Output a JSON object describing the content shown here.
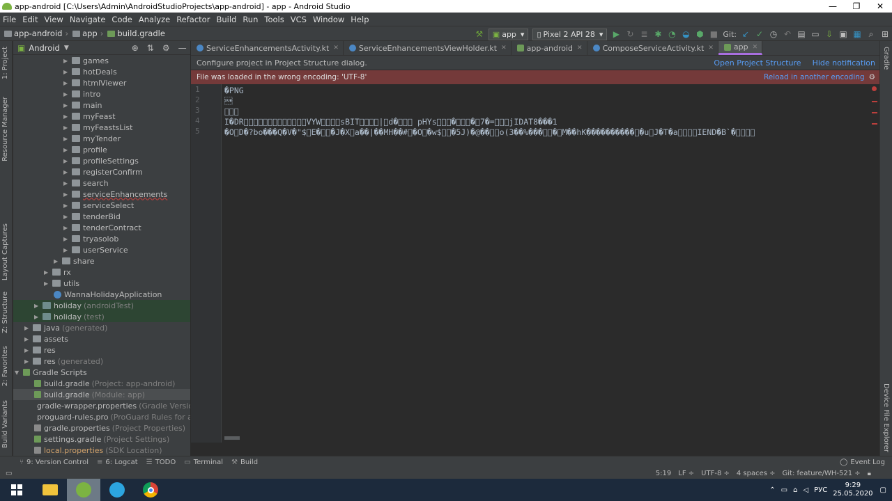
{
  "window": {
    "title": "app-android [C:\\Users\\Admin\\AndroidStudioProjects\\app-android] - app - Android Studio",
    "controls": [
      "—",
      "❐",
      "✕"
    ]
  },
  "menu": [
    "File",
    "Edit",
    "View",
    "Navigate",
    "Code",
    "Analyze",
    "Refactor",
    "Build",
    "Run",
    "Tools",
    "VCS",
    "Window",
    "Help"
  ],
  "navbar": {
    "breadcrumbs": [
      "app-android",
      "app",
      "build.gradle"
    ],
    "run_config": "app",
    "device": "Pixel 2 API 28",
    "git_label": "Git:"
  },
  "left_strip": [
    "1: Project",
    "Resource Manager",
    "Layout Captures",
    "Z: Structure",
    "2: Favorites",
    "Build Variants"
  ],
  "right_strip": [
    "Gradle",
    "Device File Explorer"
  ],
  "project_panel": {
    "view_mode": "Android",
    "tree": [
      {
        "label": "games",
        "sub": ""
      },
      {
        "label": "hotDeals",
        "sub": ""
      },
      {
        "label": "htmlViewer",
        "sub": ""
      },
      {
        "label": "intro",
        "sub": ""
      },
      {
        "label": "main",
        "sub": ""
      },
      {
        "label": "myFeast",
        "sub": ""
      },
      {
        "label": "myFeastsList",
        "sub": ""
      },
      {
        "label": "myTender",
        "sub": ""
      },
      {
        "label": "profile",
        "sub": ""
      },
      {
        "label": "profileSettings",
        "sub": ""
      },
      {
        "label": "registerConfirm",
        "sub": ""
      },
      {
        "label": "search",
        "sub": ""
      },
      {
        "label": "serviceEnhancements",
        "sub": ""
      },
      {
        "label": "serviceSelect",
        "sub": ""
      },
      {
        "label": "tenderBid",
        "sub": ""
      },
      {
        "label": "tenderContract",
        "sub": ""
      },
      {
        "label": "tryasolob",
        "sub": ""
      },
      {
        "label": "userService",
        "sub": ""
      },
      {
        "label": "share",
        "sub": ""
      },
      {
        "label": "rx",
        "sub": ""
      },
      {
        "label": "utils",
        "sub": ""
      },
      {
        "label": "WannaHolidayApplication",
        "sub": ""
      },
      {
        "label": "holiday",
        "sub": "(androidTest)"
      },
      {
        "label": "holiday",
        "sub": "(test)"
      },
      {
        "label": "java",
        "sub": "(generated)"
      },
      {
        "label": "assets",
        "sub": ""
      },
      {
        "label": "res",
        "sub": ""
      },
      {
        "label": "res",
        "sub": "(generated)"
      },
      {
        "label": "Gradle Scripts",
        "sub": ""
      },
      {
        "label": "build.gradle",
        "sub": "(Project: app-android)"
      },
      {
        "label": "build.gradle",
        "sub": "(Module: app)"
      },
      {
        "label": "gradle-wrapper.properties",
        "sub": "(Gradle Version)"
      },
      {
        "label": "proguard-rules.pro",
        "sub": "(ProGuard Rules for app)"
      },
      {
        "label": "gradle.properties",
        "sub": "(Project Properties)"
      },
      {
        "label": "settings.gradle",
        "sub": "(Project Settings)"
      },
      {
        "label": "local.properties",
        "sub": "(SDK Location)"
      }
    ]
  },
  "tabs": [
    {
      "label": "ServiceEnhancementsActivity.kt",
      "active": false
    },
    {
      "label": "ServiceEnhancementsViewHolder.kt",
      "active": false
    },
    {
      "label": "app-android",
      "active": false
    },
    {
      "label": "ComposeServiceActivity.kt",
      "active": false
    },
    {
      "label": "app",
      "active": true
    }
  ],
  "notifications": {
    "structure": {
      "text": "Configure project in Project Structure dialog.",
      "link1": "Open Project Structure",
      "link2": "Hide notification"
    },
    "encoding": {
      "text": "File was loaded in the wrong encoding: 'UTF-8'",
      "link": "Reload in another encoding"
    }
  },
  "editor": {
    "line_numbers": [
      "1",
      "2",
      "3",
      "4",
      "5"
    ],
    "lines": [
      "�PNG",
      "\u001a",
      "\u0000\u0000\u0000",
      "I�DR\u0000\u0000\u0000\u0000\u0000\u0000\u0000\u0000\u0000\u0000\u0000\u0000\u0000VYW\u0000\u0000\u0000\u0000sBIT\u0000\u0000\u0000\u0000|\u0000d�\u0000\u0000\u0000 pHYs\u0000\u0000\u0000�\u0000\u0000\u0000�\u00007�=\u0000\u0000\u0000jIDAT8���1",
      "�O\u0000D�?bo���Q�V�\"$\u0000E�\u0000\u0000�J�X\u0000a��|��MH��#\u0000�O\u0000�w$\u0000\u0000�5J)�@��\u0000\u0000o(3��%���\u0000\u0000�\u0000M��hK����������\u0000�u\u0000J�T�a\u0000\u0000\u0000\u0000IEND�B`�\u0000\u0000\u0000\u0000"
    ]
  },
  "bottom_tools": [
    {
      "icon": "⑂",
      "label": "9: Version Control"
    },
    {
      "icon": "≡",
      "label": "6: Logcat"
    },
    {
      "icon": "☰",
      "label": "TODO"
    },
    {
      "icon": "▭",
      "label": "Terminal"
    },
    {
      "icon": "⚒",
      "label": "Build"
    }
  ],
  "event_log": "Event Log",
  "status": {
    "position": "5:19",
    "line_sep": "LF ÷",
    "encoding": "UTF-8 ÷",
    "indent": "4 spaces ÷",
    "git_branch": "Git: feature/WH-521 ÷"
  },
  "taskbar": {
    "lang": "РУС",
    "time": "9:29",
    "date": "25.05.2020"
  }
}
